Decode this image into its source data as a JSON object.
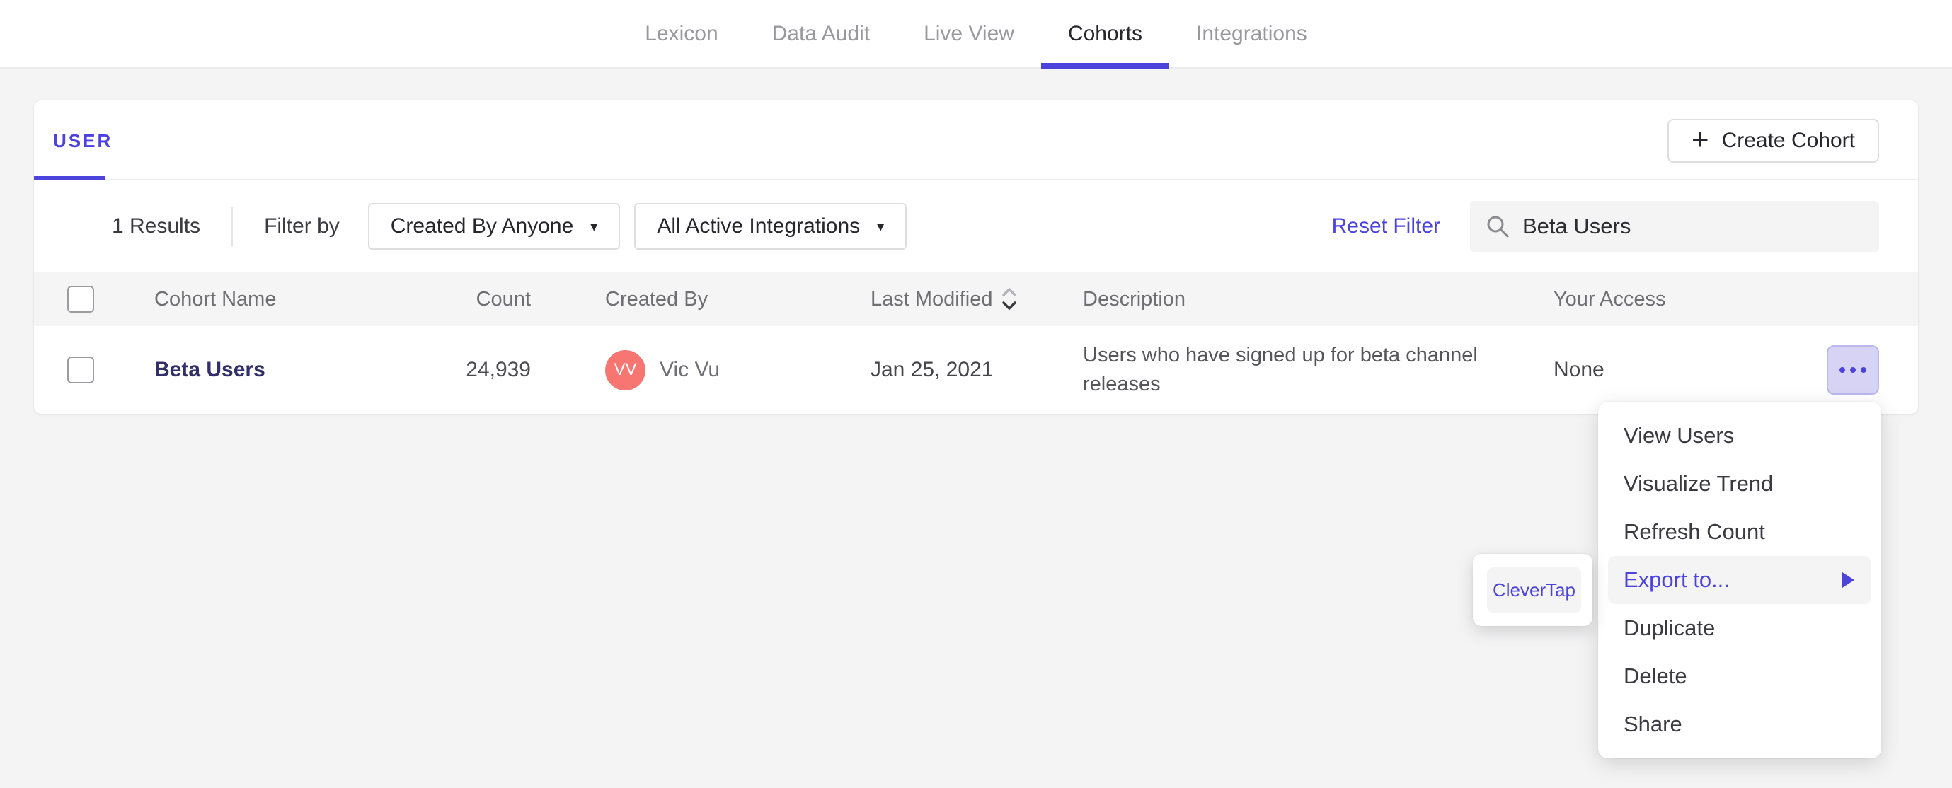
{
  "nav": {
    "tabs": [
      {
        "label": "Lexicon",
        "active": false
      },
      {
        "label": "Data Audit",
        "active": false
      },
      {
        "label": "Live View",
        "active": false
      },
      {
        "label": "Cohorts",
        "active": true
      },
      {
        "label": "Integrations",
        "active": false
      }
    ]
  },
  "panel": {
    "tab_label": "USER",
    "create_button": {
      "plus": "+",
      "label": "Create Cohort"
    },
    "filter_bar": {
      "results": "1 Results",
      "filter_by": "Filter by",
      "dropdown_created_by": "Created By Anyone",
      "dropdown_integrations": "All Active Integrations",
      "caret": "▾",
      "reset_label": "Reset Filter",
      "search_value": "Beta Users"
    },
    "table": {
      "headers": [
        "Cohort Name",
        "Count",
        "Created By",
        "Last Modified",
        "Description",
        "Your Access"
      ],
      "rows": [
        {
          "name": "Beta Users",
          "count": "24,939",
          "creator_initials": "VV",
          "creator_name": "Vic Vu",
          "last_modified": "Jan 25, 2021",
          "description": "Users who have signed up for beta channel releases",
          "access": "None"
        }
      ]
    }
  },
  "context_menu": {
    "items": [
      "View Users",
      "Visualize Trend",
      "Refresh Count",
      "Export to...",
      "Duplicate",
      "Delete",
      "Share"
    ],
    "highlighted": "Export to..."
  },
  "submenu": {
    "items": [
      "CleverTap"
    ]
  },
  "colors": {
    "accent": "#4c43dd",
    "link": "#322e68",
    "avatar": "#f77672",
    "pagebg": "#f4f4f5"
  }
}
